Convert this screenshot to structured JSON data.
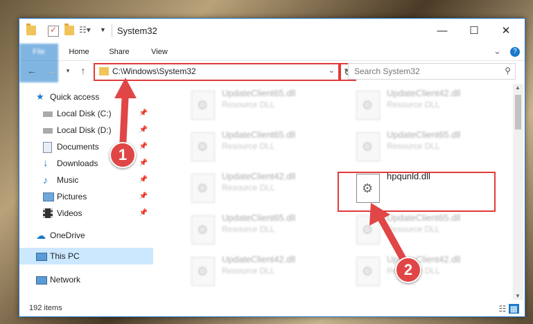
{
  "window": {
    "title": "System32",
    "controls": {
      "minimize": "—",
      "maximize": "☐",
      "close": "✕"
    }
  },
  "ribbon": {
    "tabs": [
      "File",
      "Home",
      "Share",
      "View"
    ],
    "collapse": "⌄",
    "help": "?"
  },
  "address": {
    "path": "C:\\Windows\\System32",
    "refresh": "↻"
  },
  "search": {
    "placeholder": "Search System32"
  },
  "nav": {
    "quick_access": "Quick access",
    "items": [
      {
        "label": "Local Disk (C:)",
        "icon": "drive-icon",
        "pinned": true
      },
      {
        "label": "Local Disk (D:)",
        "icon": "drive-icon",
        "pinned": true
      },
      {
        "label": "Documents",
        "icon": "documents-icon",
        "pinned": true
      },
      {
        "label": "Downloads",
        "icon": "downloads-icon",
        "pinned": true
      },
      {
        "label": "Music",
        "icon": "music-icon",
        "pinned": true
      },
      {
        "label": "Pictures",
        "icon": "pictures-icon",
        "pinned": true
      },
      {
        "label": "Videos",
        "icon": "videos-icon",
        "pinned": true
      }
    ],
    "onedrive": "OneDrive",
    "this_pc": "This PC",
    "network": "Network"
  },
  "files": [
    {
      "name": "UpdateClient65.dll",
      "type": "Resource DLL"
    },
    {
      "name": "UpdateClient42.dll",
      "type": "Resource DLL"
    },
    {
      "name": "UpdateClient65.dll",
      "type": "Resource DLL"
    },
    {
      "name": "UpdateClient65.dll",
      "type": "Resource DLL"
    },
    {
      "name": "UpdateClient42.dll",
      "type": "Resource DLL"
    },
    {
      "name": "hpqunld.dll",
      "type": ""
    },
    {
      "name": "UpdateClient65.dll",
      "type": "Resource DLL"
    },
    {
      "name": "UpdateClient65.dll",
      "type": "Resource DLL"
    },
    {
      "name": "UpdateClient42.dll",
      "type": "Resource DLL"
    },
    {
      "name": "UpdateClient42.dll",
      "type": "Resource DLL"
    }
  ],
  "status": {
    "item_count": "192 items"
  },
  "callouts": [
    "1",
    "2"
  ],
  "colors": {
    "accent": "#1979ca",
    "highlight": "#e03a3a",
    "selected": "#cce8ff"
  }
}
